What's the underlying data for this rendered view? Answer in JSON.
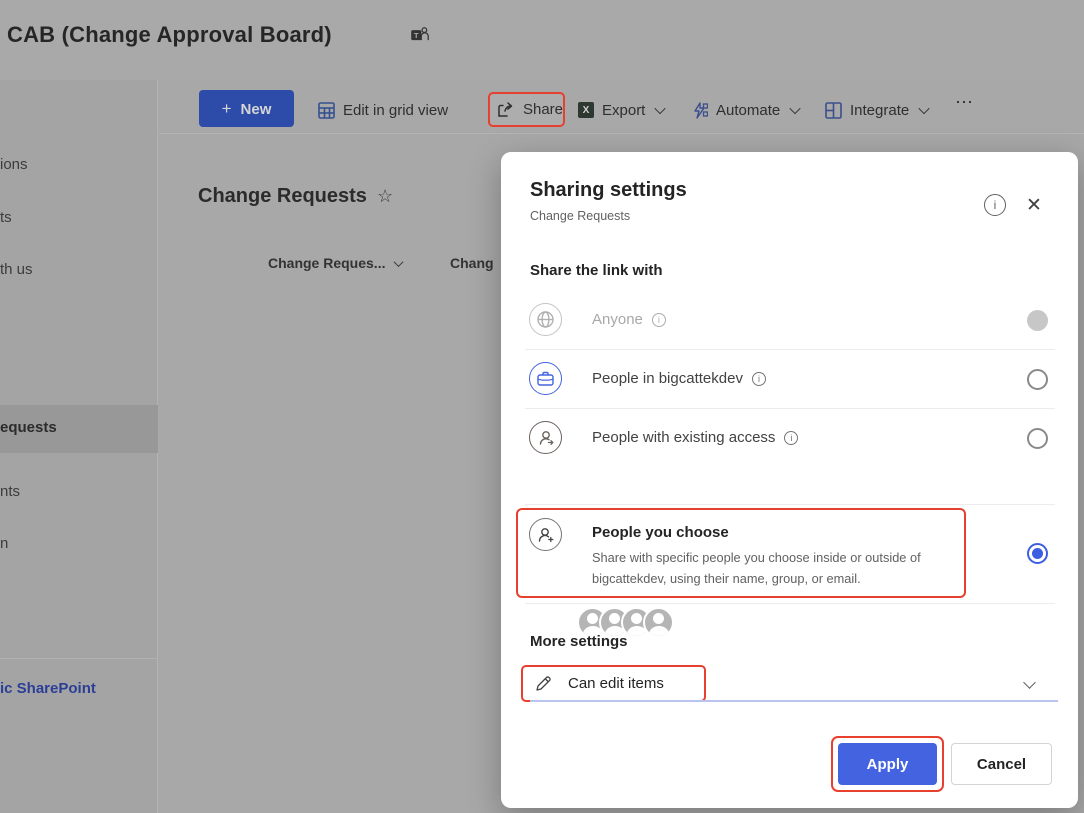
{
  "header": {
    "title": "CAB (Change Approval Board)",
    "teams_icon": "teams-logo"
  },
  "sidebar": {
    "items": [
      {
        "label": "ions"
      },
      {
        "label": "ts"
      },
      {
        "label": "th us"
      },
      {
        "label": "equests",
        "selected": true
      },
      {
        "label": "nts"
      },
      {
        "label": "n"
      }
    ],
    "footer_link": "ic SharePoint"
  },
  "toolbar": {
    "new_label": "New",
    "new_plus": "+",
    "edit_label": "Edit in grid view",
    "share_label": "Share",
    "export_label": "Export",
    "automate_label": "Automate",
    "integrate_label": "Integrate",
    "more_label": "⋯",
    "excel_glyph": "X"
  },
  "content": {
    "title": "Change Requests",
    "star": "☆",
    "columns": [
      "Change Reques...",
      "Chang"
    ]
  },
  "dialog": {
    "title": "Sharing settings",
    "subtitle": "Change Requests",
    "info_glyph": "i",
    "close_glyph": "✕",
    "section": "Share the link with",
    "options": [
      {
        "label": "Anyone",
        "icon": "globe-icon",
        "state": "disabled"
      },
      {
        "label": "People in bigcattekdev",
        "icon": "briefcase-icon",
        "state": "unselected"
      },
      {
        "label": "People with existing access",
        "icon": "person-icon",
        "state": "unselected"
      },
      {
        "label": "People you choose",
        "icon": "person-add-icon",
        "state": "selected",
        "description": "Share with specific people you choose inside or outside of bigcattekdev, using their name, group, or email."
      }
    ],
    "existing_access_avatar_count": 4,
    "more_settings": "More settings",
    "permission_value": "Can edit items",
    "apply_label": "Apply",
    "cancel_label": "Cancel"
  },
  "colors": {
    "accent_blue": "#4363e1",
    "annotation_red": "#e8402f",
    "link_blue": "#2b3f96",
    "dim_background": "#a9a9a9"
  }
}
